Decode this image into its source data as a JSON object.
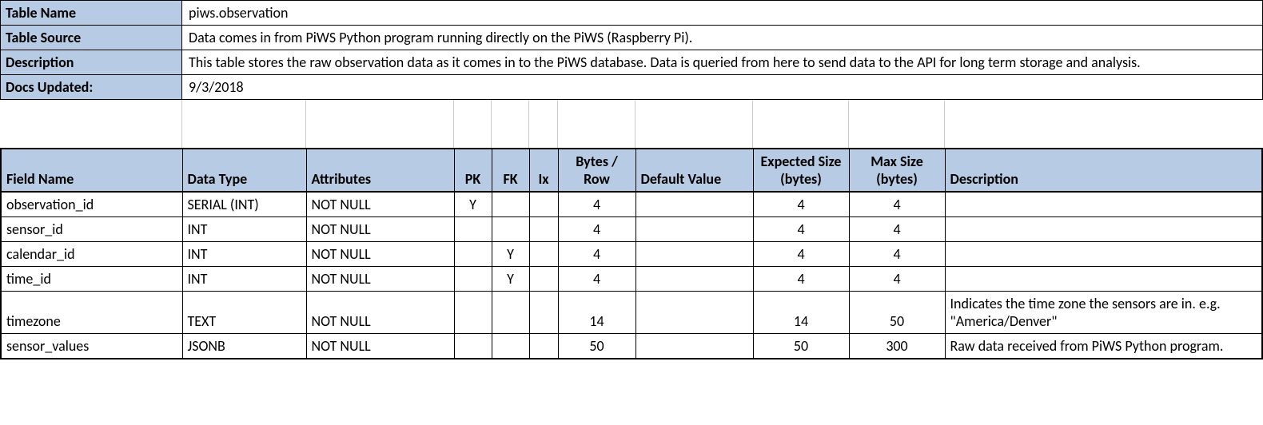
{
  "meta": {
    "labels": {
      "tableName": "Table Name",
      "tableSource": "Table Source",
      "description": "Description",
      "docsUpdated": "Docs Updated:"
    },
    "values": {
      "tableName": "piws.observation",
      "tableSource": "Data comes in from PiWS Python program running directly on the PiWS (Raspberry Pi).",
      "description": "This table stores the raw observation data as it comes in to the PiWS database.  Data is queried from here to send data to the API for long term storage and analysis.",
      "docsUpdated": "9/3/2018"
    }
  },
  "schema": {
    "headers": {
      "fieldName": "Field Name",
      "dataType": "Data Type",
      "attributes": "Attributes",
      "pk": "PK",
      "fk": "FK",
      "ix": "Ix",
      "bytesRow": "Bytes / Row",
      "defaultValue": "Default Value",
      "expectedSize": "Expected Size (bytes)",
      "maxSize": "Max Size (bytes)",
      "description": "Description"
    },
    "rows": [
      {
        "fieldName": "observation_id",
        "dataType": "SERIAL (INT)",
        "attributes": "NOT NULL",
        "pk": "Y",
        "fk": "",
        "ix": "",
        "bytesRow": "4",
        "defaultValue": "",
        "expectedSize": "4",
        "maxSize": "4",
        "description": ""
      },
      {
        "fieldName": "sensor_id",
        "dataType": "INT",
        "attributes": "NOT NULL",
        "pk": "",
        "fk": "",
        "ix": "",
        "bytesRow": "4",
        "defaultValue": "",
        "expectedSize": "4",
        "maxSize": "4",
        "description": ""
      },
      {
        "fieldName": "calendar_id",
        "dataType": "INT",
        "attributes": "NOT NULL",
        "pk": "",
        "fk": "Y",
        "ix": "",
        "bytesRow": "4",
        "defaultValue": "",
        "expectedSize": "4",
        "maxSize": "4",
        "description": ""
      },
      {
        "fieldName": "time_id",
        "dataType": "INT",
        "attributes": "NOT NULL",
        "pk": "",
        "fk": "Y",
        "ix": "",
        "bytesRow": "4",
        "defaultValue": "",
        "expectedSize": "4",
        "maxSize": "4",
        "description": ""
      },
      {
        "fieldName": "timezone",
        "dataType": "TEXT",
        "attributes": "NOT NULL",
        "pk": "",
        "fk": "",
        "ix": "",
        "bytesRow": "14",
        "defaultValue": "",
        "expectedSize": "14",
        "maxSize": "50",
        "description": "Indicates the time zone the sensors are in.  e.g. \"America/Denver\""
      },
      {
        "fieldName": "sensor_values",
        "dataType": "JSONB",
        "attributes": "NOT NULL",
        "pk": "",
        "fk": "",
        "ix": "",
        "bytesRow": "50",
        "defaultValue": "",
        "expectedSize": "50",
        "maxSize": "300",
        "description": "Raw data received from PiWS Python program."
      }
    ]
  }
}
